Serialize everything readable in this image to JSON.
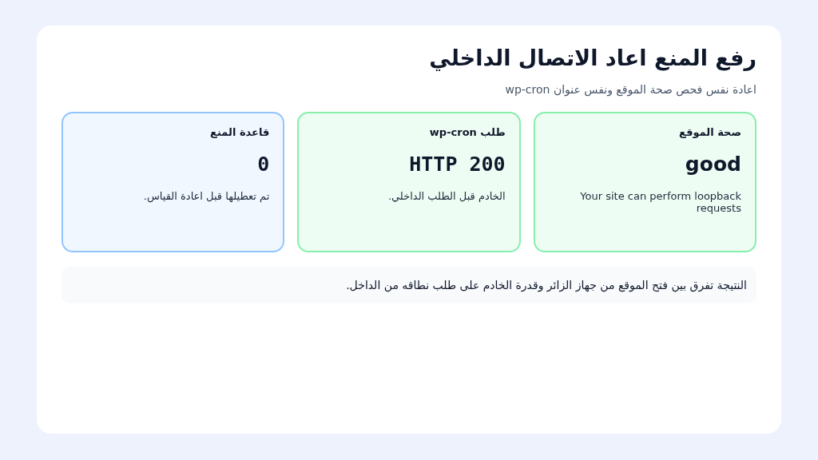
{
  "title": "رفع المنع اعاد الاتصال الداخلي",
  "subtitle": "اعادة نفس فحص صحة الموقع ونفس عنوان wp-cron",
  "cards": [
    {
      "label": "صحة الموقع",
      "value": "good",
      "kind": "word",
      "note": "Your site can perform loopback requests",
      "color": "#86efac"
    },
    {
      "label": "طلب wp-cron",
      "value": "HTTP 200",
      "kind": "code",
      "note": "الخادم قبل الطلب الداخلي.",
      "color": "#86efac"
    },
    {
      "label": "قاعدة المنع",
      "value": "0",
      "kind": "code",
      "note": "تم تعطيلها قبل اعادة القياس.",
      "color": "#93c5fd"
    }
  ],
  "footer_note": "النتيجة تفرق بين فتح الموقع من جهاز الزائر وقدرة الخادم على طلب نطاقه من الداخل."
}
